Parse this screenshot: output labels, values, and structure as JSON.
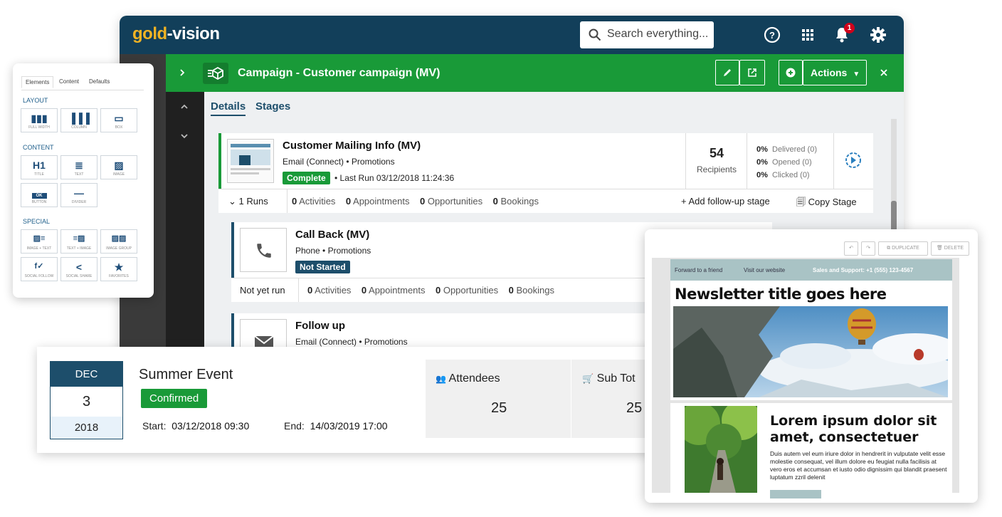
{
  "app": {
    "logo_part1": "gold",
    "logo_part2": "-vision",
    "search_placeholder": "Search everything...",
    "notification_count": "1",
    "campaign_title": "Campaign - Customer campaign (MV)",
    "actions_label": "Actions",
    "tabs": [
      "Details",
      "Stages"
    ]
  },
  "stage1": {
    "title": "Customer Mailing Info (MV)",
    "subtitle": "Email (Connect)  •  Promotions",
    "status": "Complete",
    "last_run": "•  Last Run 03/12/2018 11:24:36",
    "recipients_count": "54",
    "recipients_label": "Recipients",
    "delivered_pct": "0%",
    "delivered": "Delivered (0)",
    "opened_pct": "0%",
    "opened": "Opened (0)",
    "clicked_pct": "0%",
    "clicked": "Clicked (0)",
    "runs": "1 Runs",
    "activities_n": "0",
    "activities": "Activities",
    "appointments_n": "0",
    "appointments": "Appointments",
    "opportunities_n": "0",
    "opportunities": "Opportunities",
    "bookings_n": "0",
    "bookings": "Bookings",
    "add_followup": "Add follow-up stage",
    "copy_stage": "Copy Stage"
  },
  "stage2": {
    "title": "Call Back (MV)",
    "subtitle": "Phone  •  Promotions",
    "status": "Not Started",
    "run_state": "Not yet run",
    "activities_n": "0",
    "activities": "Activities",
    "appointments_n": "0",
    "appointments": "Appointments",
    "opportunities_n": "0",
    "opportunities": "Opportunities",
    "bookings_n": "0",
    "bookings": "Bookings"
  },
  "stage3": {
    "title": "Follow up",
    "subtitle": "Email (Connect)  •  Promotions"
  },
  "editor": {
    "tabs": [
      "Elements",
      "Content",
      "Defaults"
    ],
    "layout_head": "LAYOUT",
    "layout": [
      "FULL WIDTH",
      "COLUMN",
      "BOX"
    ],
    "content_head": "CONTENT",
    "content": [
      "TITLE",
      "TEXT",
      "IMAGE",
      "BUTTON",
      "DIVIDER"
    ],
    "title_glyph": "H1",
    "button_glyph": "OK",
    "special_head": "SPECIAL",
    "special": [
      "IMAGE + TEXT",
      "TEXT + IMAGE",
      "IMAGE GROUP",
      "SOCIAL FOLLOW",
      "SOCIAL SHARE",
      "FAVORITES"
    ]
  },
  "event": {
    "month": "DEC",
    "day": "3",
    "year": "2018",
    "title": "Summer Event",
    "status": "Confirmed",
    "start_label": "Start:",
    "start": "03/12/2018 09:30",
    "end_label": "End:",
    "end": "14/03/2019 17:00",
    "attendees_label": "Attendees",
    "attendees": "25",
    "subtotal_label": "Sub Tot",
    "subtotal": "25"
  },
  "newsletter": {
    "duplicate": "DUPLICATE",
    "delete": "DELETE",
    "forward": "Forward to a friend",
    "visit": "Visit our website",
    "support": "Sales and Support: +1 (555) 123-4567",
    "title": "Newsletter title goes here",
    "lorem_title": "Lorem ipsum dolor sit amet, consectetuer",
    "lorem_body": "Duis autem vel eum iriure dolor in hendrerit in vulputate velit esse molestie consequat, vel illum dolore eu feugiat nulla facilisis at vero eros et accumsan et iusto odio dignissim qui blandit praesent luptatum zzril delenit"
  },
  "colors": {
    "navy": "#123f5a",
    "green": "#199a38",
    "gold": "#f0b323",
    "badge_red": "#d0021b"
  }
}
